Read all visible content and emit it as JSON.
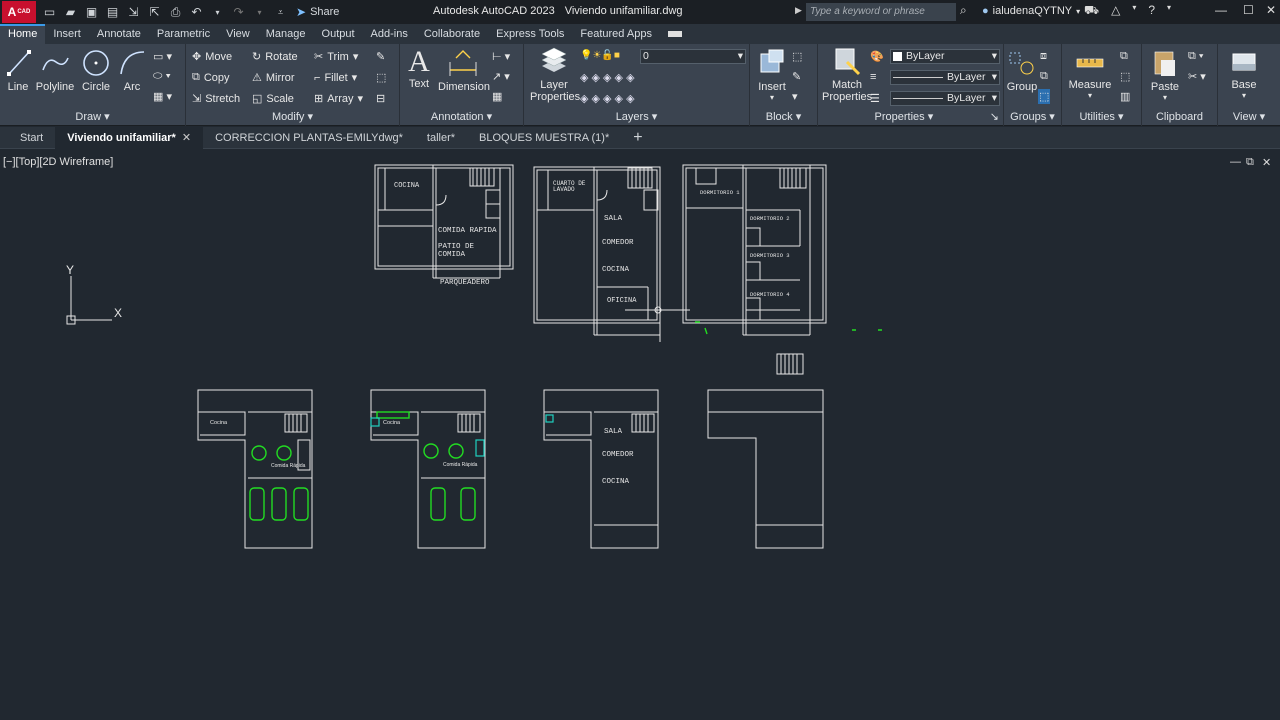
{
  "titlebar": {
    "app_badge": "A",
    "app_badge_sub": "CAD",
    "share_label": "Share",
    "app_name": "Autodesk AutoCAD 2023",
    "doc_name": "Viviendo unifamiliar.dwg",
    "search_placeholder": "Type a keyword or phrase",
    "user": "ialudenaQYTNY"
  },
  "ribbon_tabs": [
    "Home",
    "Insert",
    "Annotate",
    "Parametric",
    "View",
    "Manage",
    "Output",
    "Add-ins",
    "Collaborate",
    "Express Tools",
    "Featured Apps"
  ],
  "draw": {
    "title": "Draw",
    "line": "Line",
    "polyline": "Polyline",
    "circle": "Circle",
    "arc": "Arc"
  },
  "modify": {
    "title": "Modify",
    "move": "Move",
    "rotate": "Rotate",
    "trim": "Trim",
    "copy": "Copy",
    "mirror": "Mirror",
    "fillet": "Fillet",
    "stretch": "Stretch",
    "scale": "Scale",
    "array": "Array"
  },
  "annotation": {
    "title": "Annotation",
    "text": "Text",
    "dimension": "Dimension"
  },
  "layers": {
    "title": "Layers",
    "layer_properties_1": "Layer",
    "layer_properties_2": "Properties",
    "current_layer": "0"
  },
  "block": {
    "title": "Block",
    "insert": "Insert"
  },
  "properties": {
    "title": "Properties",
    "match_1": "Match",
    "match_2": "Properties",
    "color": "ByLayer",
    "linetype": "ByLayer",
    "lineweight": "ByLayer"
  },
  "groups": {
    "title": "Groups",
    "group": "Group"
  },
  "utilities": {
    "title": "Utilities",
    "measure": "Measure"
  },
  "clipboard": {
    "title": "Clipboard",
    "paste": "Paste"
  },
  "view_panel": {
    "title": "View",
    "base": "Base"
  },
  "doc_tabs": [
    "Start",
    "Viviendo unifamiliar*",
    "CORRECCION PLANTAS-EMILYdwg*",
    "taller*",
    "BLOQUES MUESTRA (1)*"
  ],
  "viewport": {
    "label": "[−][Top][2D Wireframe]",
    "ucs_x": "X",
    "ucs_y": "Y"
  },
  "drawing_labels": {
    "p1_cocina": "COCINA",
    "p1_comida": "COMIDA RAPIDA",
    "p1_patio_1": "PATIO DE",
    "p1_patio_2": "COMIDA",
    "p1_parq": "PARQUEADERO",
    "p2_cuarto_1": "CUARTO DE",
    "p2_cuarto_2": "LAVADO",
    "p2_sala": "SALA",
    "p2_comedor": "COMEDOR",
    "p2_cocina": "COCINA",
    "p2_oficina": "OFICINA",
    "p3_d1": "DORMITORIO 1",
    "p3_d2": "DORMITORIO 2",
    "p3_d3": "DORMITORIO 3",
    "p3_d4": "DORMITORIO 4",
    "b1_cocina": "Cocina",
    "b1_comida": "Comida Rápida",
    "b2_cocina": "Cocina",
    "b2_comida": "Comida Rápida",
    "b3_sala": "SALA",
    "b3_comedor": "COMEDOR",
    "b3_cocina": "COCINA"
  },
  "colors": {
    "accent": "#3b9ae8",
    "cad_lines": "#e6e6e6",
    "block_green": "#22dd22",
    "block_cyan": "#20d0c0"
  }
}
